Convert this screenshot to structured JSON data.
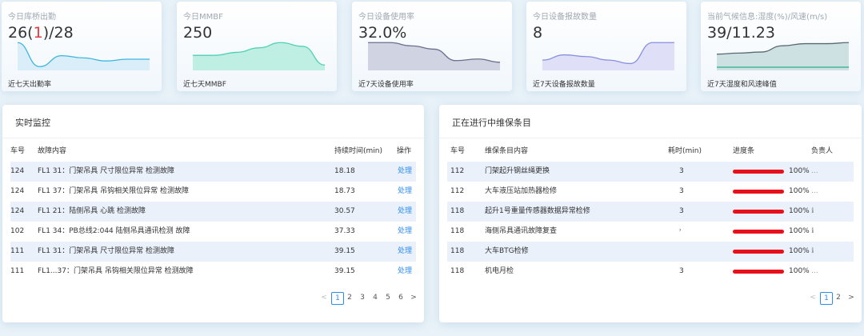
{
  "kpis": [
    {
      "title": "今日库桥出勤",
      "value_pre": "26(",
      "value_red": "1",
      "value_post": ")/28",
      "footer": "近七天出勤率",
      "colors": {
        "line": "#3bb6e0",
        "fill": "#d9eef8"
      },
      "series": [
        60,
        5,
        30,
        25,
        18,
        22,
        22
      ]
    },
    {
      "title": "今日MMBF",
      "value_pre": "250",
      "value_red": "",
      "value_post": "",
      "footer": "近七天MMBF",
      "colors": {
        "line": "#4fd1b7",
        "fill": "#bfeee3"
      },
      "series": [
        18,
        18,
        22,
        28,
        35,
        30,
        5
      ]
    },
    {
      "title": "今日设备使用率",
      "value_pre": "32.0%",
      "value_red": "",
      "value_post": "",
      "footer": "近7天设备使用率",
      "colors": {
        "line": "#6a6f8e",
        "fill": "#cfd3e2"
      },
      "series": [
        32,
        32,
        28,
        24,
        10,
        12,
        8
      ]
    },
    {
      "title": "今日设备报故数量",
      "value_pre": "8",
      "value_red": "",
      "value_post": "",
      "footer": "近7天设备报故数量",
      "colors": {
        "line": "#8a8ee0",
        "fill": "#dfe0f7"
      },
      "series": [
        10,
        16,
        14,
        10,
        6,
        30,
        30
      ]
    },
    {
      "title": "当前气候信息:湿度(%)/风速(m/s)",
      "value_pre": "39/11.23",
      "value_red": "",
      "value_post": "",
      "footer": "近7天湿度和风速峰值",
      "colors": {
        "line": "#5a6a72",
        "fill": "#cde0e2",
        "line2": "#28b08a"
      },
      "series": [
        14,
        15,
        16,
        22,
        24,
        24,
        25
      ]
    }
  ],
  "monitor": {
    "title": "实时监控",
    "headers": [
      "车号",
      "故障内容",
      "持续时间(min)",
      "操作"
    ],
    "rows": [
      {
        "car": "124",
        "fault": "FL1    31：门架吊具 尺寸限位异常 检测故障",
        "duration": "18.18",
        "action": "处理"
      },
      {
        "car": "124",
        "fault": "FL1    37：门架吊具 吊钩相关限位异常 检测故障",
        "duration": "18.73",
        "action": "处理"
      },
      {
        "car": "124",
        "fault": "FL1    21：陆侧吊具 心跳 检测故障",
        "duration": "30.57",
        "action": "处理"
      },
      {
        "car": "102",
        "fault": "FL1    34：PB总线2:044 陆侧吊具通讯检测 故障",
        "duration": "37.33",
        "action": "处理"
      },
      {
        "car": "111",
        "fault": "FL1    31：门架吊具 尺寸限位异常 检测故障",
        "duration": "39.15",
        "action": "处理"
      },
      {
        "car": "111",
        "fault": "FL1...37：门架吊具 吊钩相关限位异常 检测故障",
        "duration": "39.15",
        "action": "处理"
      }
    ],
    "pager": {
      "prev": "<",
      "pages": [
        "1",
        "2",
        "3",
        "4",
        "5",
        "6"
      ],
      "active": "1",
      "next": ">"
    }
  },
  "maint": {
    "title": "正在进行中维保条目",
    "headers": [
      "车号",
      "维保条目内容",
      "耗时(min)",
      "进度条",
      "负责人"
    ],
    "rows": [
      {
        "car": "112",
        "item": "门架起升钢丝绳更换",
        "time": "3",
        "progress": 100,
        "progress_label": "100%",
        "owner": "..."
      },
      {
        "car": "112",
        "item": "大车液压站加热器检修",
        "time": "3",
        "progress": 100,
        "progress_label": "100%",
        "owner": "..."
      },
      {
        "car": "118",
        "item": "起升1号重量传感器数据异常检修",
        "time": "3",
        "progress": 100,
        "progress_label": "100%",
        "owner": "ℹ"
      },
      {
        "car": "118",
        "item": "海侧吊具通讯故障复查",
        "time": "˒",
        "progress": 100,
        "progress_label": "100%",
        "owner": "ℹ"
      },
      {
        "car": "118",
        "item": "大车BTG检修",
        "time": "",
        "progress": 100,
        "progress_label": "100%",
        "owner": "ℹ"
      },
      {
        "car": "118",
        "item": "机电月检",
        "time": "3",
        "progress": 100,
        "progress_label": "100%",
        "owner": "..."
      }
    ],
    "pager": {
      "prev": "<",
      "pages": [
        "1",
        "2"
      ],
      "active": "1",
      "next": ">"
    }
  },
  "colors": {
    "accent": "#2d8cf0",
    "progress": "#e8101a",
    "row_alt": "#eaf1fb"
  }
}
